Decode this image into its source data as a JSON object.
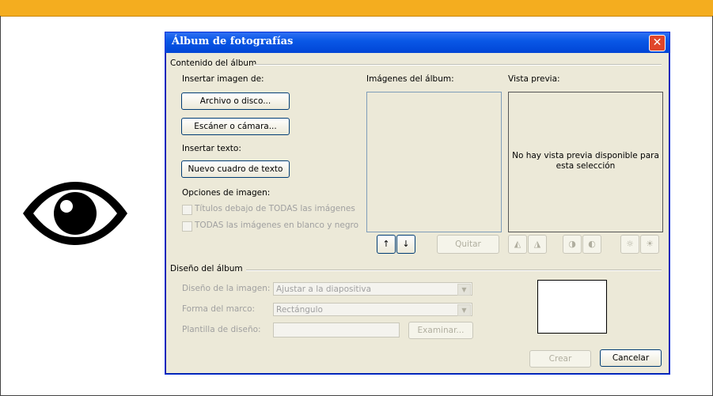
{
  "dialog": {
    "title": "Álbum de fotografías",
    "close_icon": "close-icon"
  },
  "content": {
    "section_label": "Contenido del álbum",
    "insert_image_label": "Insertar imagen de:",
    "file_button": "Archivo o disco...",
    "scanner_button": "Escáner o cámara...",
    "insert_text_label": "Insertar texto:",
    "text_box_button": "Nuevo cuadro de texto",
    "image_options_label": "Opciones de imagen:",
    "captions_checkbox": "Títulos debajo de TODAS las imágenes",
    "bw_checkbox": "TODAS las imágenes en blanco y negro",
    "album_images_label": "Imágenes del álbum:",
    "preview_label": "Vista previa:",
    "preview_message_line1": "No hay vista previa disponible para",
    "preview_message_line2": "esta selección",
    "move_up_icon": "↑",
    "move_down_icon": "↓",
    "remove_button": "Quitar"
  },
  "layout_section": {
    "section_label": "Diseño del álbum",
    "picture_layout_label": "Diseño de la imagen:",
    "picture_layout_value": "Ajustar a la diapositiva",
    "frame_shape_label": "Forma del marco:",
    "frame_shape_value": "Rectángulo",
    "design_template_label": "Plantilla de diseño:",
    "browse_button": "Examinar...",
    "create_button": "Crear",
    "cancel_button": "Cancelar"
  },
  "colors": {
    "top_bar": "#f4ad1f",
    "titlebar": "#0a58e6",
    "dialog_bg": "#ece9d8"
  }
}
